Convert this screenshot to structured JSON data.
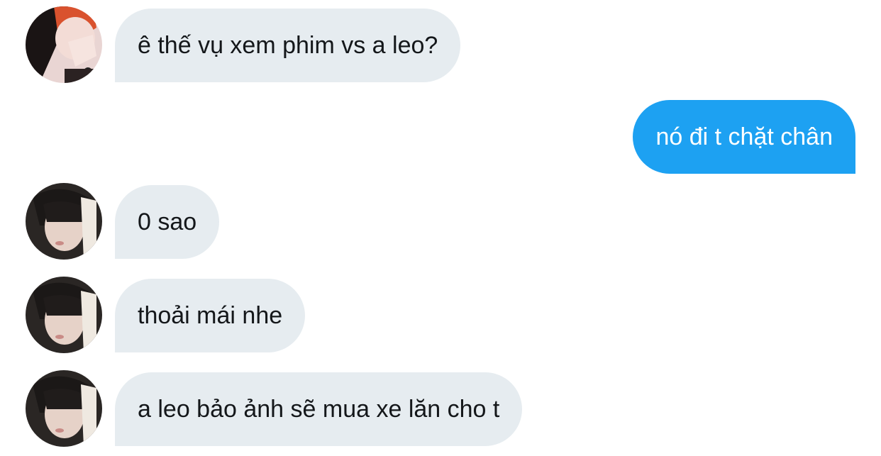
{
  "conversation": {
    "messages": [
      {
        "direction": "incoming",
        "avatar": "avatar-red-hair",
        "text": "ê thế vụ xem phim vs a leo?"
      },
      {
        "direction": "outgoing",
        "text": "nó đi t chặt chân"
      },
      {
        "direction": "incoming",
        "avatar": "avatar-dark-hair",
        "text": "0 sao"
      },
      {
        "direction": "incoming",
        "avatar": "avatar-dark-hair",
        "text": "thoải mái nhe"
      },
      {
        "direction": "incoming",
        "avatar": "avatar-dark-hair",
        "text": "a leo bảo ảnh sẽ mua xe lăn cho t"
      }
    ]
  },
  "colors": {
    "incoming_bubble": "#e6ecf0",
    "outgoing_bubble": "#1da1f2",
    "incoming_text": "#14171a",
    "outgoing_text": "#ffffff"
  }
}
